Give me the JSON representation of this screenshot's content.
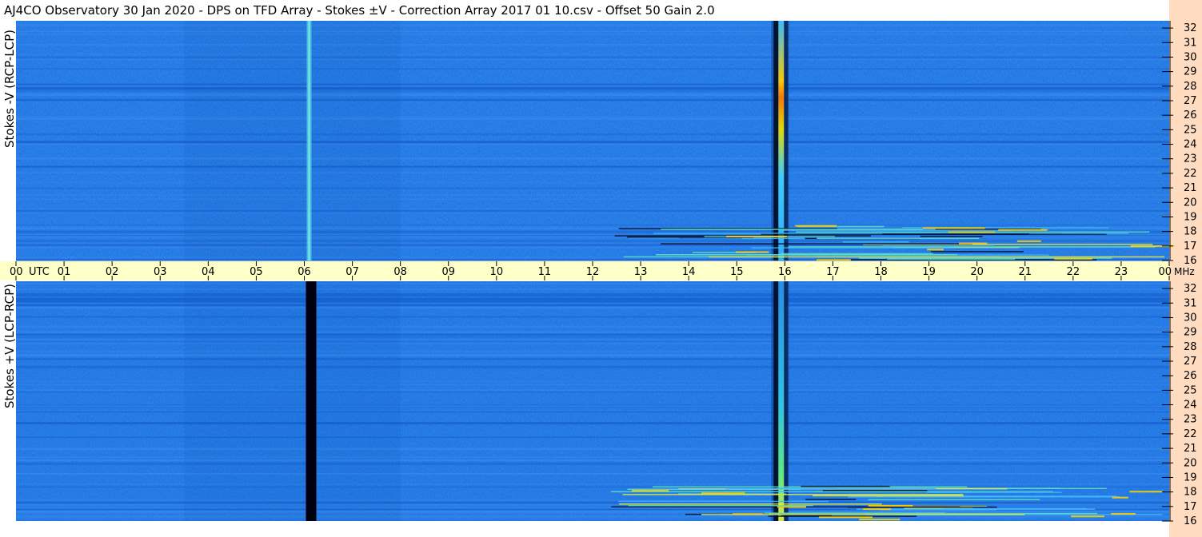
{
  "title": "AJ4CO Observatory  30 Jan 2020  -  DPS on TFD Array  -  Stokes ±V  -  Correction Array 2017 01 10.csv  -  Offset 50  Gain 2.0",
  "colors": {
    "background": "#ffffff",
    "time_axis_band": "#ffffc8",
    "freq_axis_band": "#ffdcc0",
    "spectrogram_base": "#1a6fe0",
    "burst_hot": "#ffd000",
    "dark_band": "#000010"
  },
  "chart_data": [
    {
      "type": "heatmap",
      "panel": "top",
      "ylabel": "Stokes -V (RCP-LCP)",
      "x_ticks": [
        "00",
        "01",
        "02",
        "03",
        "04",
        "05",
        "06",
        "07",
        "08",
        "09",
        "10",
        "11",
        "12",
        "13",
        "14",
        "15",
        "16",
        "17",
        "18",
        "19",
        "20",
        "21",
        "22",
        "23",
        "00"
      ],
      "x_unit": "UTC",
      "xlim": [
        0,
        24
      ],
      "y_ticks": [
        "16",
        "17",
        "18",
        "19",
        "20",
        "21",
        "22",
        "23",
        "24",
        "25",
        "26",
        "27",
        "28",
        "29",
        "30",
        "31",
        "32"
      ],
      "y_unit": "MHz",
      "ylim": [
        16,
        32.5
      ],
      "features": [
        {
          "kind": "bright-vertical-line",
          "t": 6.1
        },
        {
          "kind": "burst-vertical",
          "t": 15.9
        },
        {
          "kind": "low-frequency-interference",
          "t_start": 12.3,
          "t_end": 24,
          "f_max": 18.5
        }
      ]
    },
    {
      "type": "heatmap",
      "panel": "bottom",
      "ylabel": "Stokes +V (LCP-RCP)",
      "x_ticks": [
        "00",
        "01",
        "02",
        "03",
        "04",
        "05",
        "06",
        "07",
        "08",
        "09",
        "10",
        "11",
        "12",
        "13",
        "14",
        "15",
        "16",
        "17",
        "18",
        "19",
        "20",
        "21",
        "22",
        "23",
        "00"
      ],
      "x_unit": "UTC",
      "xlim": [
        0,
        24
      ],
      "y_ticks": [
        "16",
        "17",
        "18",
        "19",
        "20",
        "21",
        "22",
        "23",
        "24",
        "25",
        "26",
        "27",
        "28",
        "29",
        "30",
        "31",
        "32"
      ],
      "y_unit": "MHz",
      "ylim": [
        16,
        32.5
      ],
      "features": [
        {
          "kind": "dark-vertical-band",
          "t": 6.1
        },
        {
          "kind": "burst-vertical",
          "t": 15.9
        },
        {
          "kind": "low-frequency-interference",
          "t_start": 12.3,
          "t_end": 24,
          "f_max": 18.5
        }
      ]
    }
  ]
}
